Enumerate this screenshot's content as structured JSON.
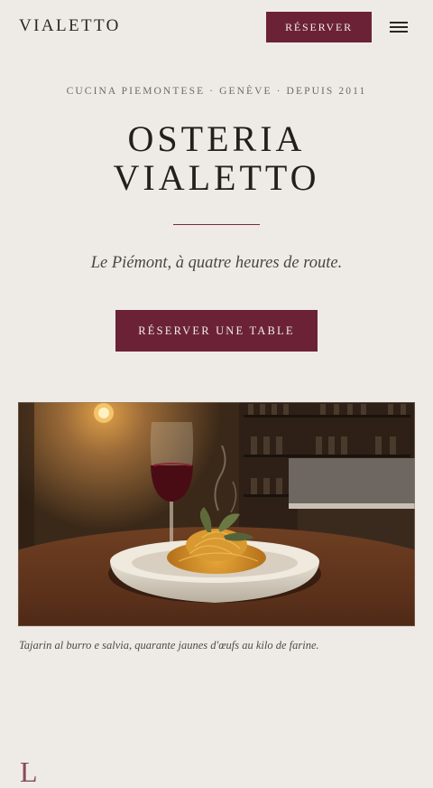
{
  "header": {
    "brand": "VIALETTO",
    "reserve_label": "RÉSERVER",
    "menu_icon": "hamburger-menu-icon"
  },
  "hero": {
    "eyebrow": "CUCINA PIEMONTESE · GENÈVE · DEPUIS 2011",
    "title_line1": "OSTERIA",
    "title_line2": "VIALETTO",
    "tagline": "Le Piémont, à quatre heures de route.",
    "cta_label": "RÉSERVER UNE TABLE"
  },
  "feature": {
    "image_subject": "tajarin-pasta-with-red-wine",
    "caption": "Tajarin al burro e salvia, quarante jaunes d'œufs au kilo de farine."
  },
  "next_section": {
    "initial": "L"
  },
  "colors": {
    "background": "#eeebe6",
    "accent": "#6b2237",
    "text": "#2a2623"
  }
}
